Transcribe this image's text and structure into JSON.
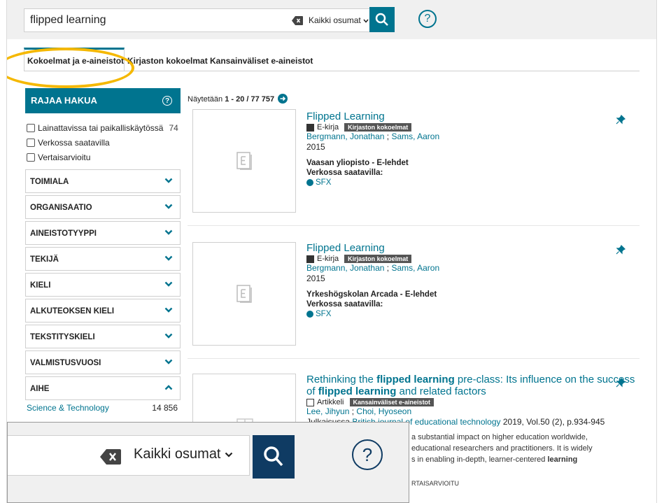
{
  "search": {
    "query": "flipped learning",
    "scope": "Kaikki osumat",
    "help": "?"
  },
  "tabs": [
    {
      "label": "Kokoelmat ja e-aineistot"
    },
    {
      "label": "Kirjaston kokoelmat"
    },
    {
      "label": "Kansainväliset e-aineistot"
    }
  ],
  "sidebar": {
    "title": "RAJAA HAKUA",
    "help": "?",
    "checkboxes": [
      {
        "label": "Lainattavissa tai paikalliskäytössä",
        "count": "74"
      },
      {
        "label": "Verkossa saatavilla"
      },
      {
        "label": "Vertaisarvioitu"
      }
    ],
    "facets": [
      {
        "label": "TOIMIALA"
      },
      {
        "label": "ORGANISAATIO"
      },
      {
        "label": "AINEISTOTYYPPI"
      },
      {
        "label": "TEKIJÄ"
      },
      {
        "label": "KIELI"
      },
      {
        "label": "ALKUTEOKSEN KIELI"
      },
      {
        "label": "TEKSTITYSKIELI"
      },
      {
        "label": "VALMISTUSVUOSI"
      },
      {
        "label": "AIHE"
      }
    ],
    "aihe_items": [
      {
        "label": "Science & Technology",
        "count": "14 856"
      }
    ]
  },
  "results": {
    "prefix": "Näytetään ",
    "range": "1 - 20",
    "sep": " / ",
    "total": "77 757",
    "records": [
      {
        "title": "Flipped Learning",
        "format": "E-kirja",
        "badge": "Kirjaston kokoelmat",
        "author1": "Bergmann, Jonathan",
        "author2": "Sams, Aaron",
        "year": "2015",
        "org": "Vaasan yliopisto - E-lehdet",
        "online": "Verkossa saatavilla:",
        "link": "SFX"
      },
      {
        "title": "Flipped Learning",
        "format": "E-kirja",
        "badge": "Kirjaston kokoelmat",
        "author1": "Bergmann, Jonathan",
        "author2": "Sams, Aaron",
        "year": "2015",
        "org": "Yrkeshögskolan Arcada - E-lehdet",
        "online": "Verkossa saatavilla:",
        "link": "SFX"
      },
      {
        "title_part1": "Rethinking the ",
        "title_part2": "flipped learning",
        "title_part3": " pre-class: Its influence on the success of ",
        "title_part4": "flipped learning",
        "title_part5": " and related factors",
        "format": "Artikkeli",
        "badge": "Kansainväliset e-aineistot",
        "author1": "Lee, Jihyun",
        "author2": "Choi, Hyoseon",
        "in_label": "Julkaisussa ",
        "journal": "British journal of educational technology",
        "citation": " 2019, Vol.50 (2), p.934-945",
        "abstract_1": "a substantial impact on higher education worldwide,",
        "abstract_2": "educational researchers and practitioners. It is widely",
        "abstract_3a": "s in enabling in-depth, learner-centered ",
        "abstract_3b": "learning",
        "peer": "RTAISARVIOITU"
      }
    ]
  },
  "colors": {
    "accent": "#00748f",
    "zoom_accent": "#0f3b63",
    "highlight": "#f5b800"
  }
}
